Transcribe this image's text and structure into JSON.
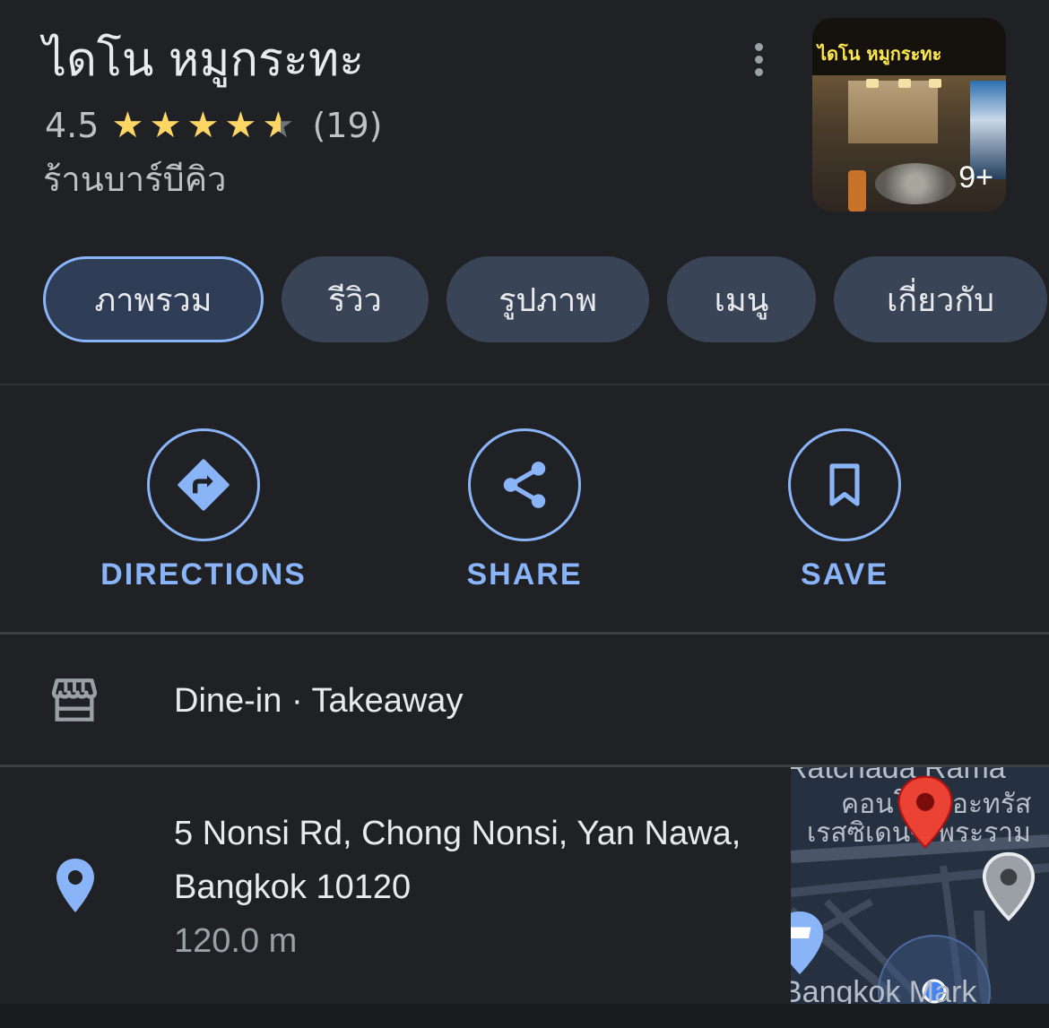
{
  "place": {
    "name": "ไดโน หมูกระทะ",
    "rating": "4.5",
    "rating_value": 4.5,
    "review_count": "(19)",
    "category": "ร้านบาร์บีคิว",
    "photo_sign": "ไดโน หมูกระทะ",
    "photo_count": "9+"
  },
  "tabs": [
    {
      "label": "ภาพรวม",
      "active": true
    },
    {
      "label": "รีวิว",
      "active": false
    },
    {
      "label": "รูปภาพ",
      "active": false
    },
    {
      "label": "เมนู",
      "active": false
    },
    {
      "label": "เกี่ยวกับ",
      "active": false
    }
  ],
  "actions": {
    "directions": {
      "label": "DIRECTIONS",
      "icon": "directions-icon"
    },
    "share": {
      "label": "SHARE",
      "icon": "share-icon"
    },
    "save": {
      "label": "SAVE",
      "icon": "bookmark-icon"
    }
  },
  "service": {
    "icon": "storefront-icon",
    "text": "Dine-in · Takeaway"
  },
  "location": {
    "icon": "location-pin-icon",
    "address": "5 Nonsi Rd, Chong Nonsi, Yan Nawa, Bangkok 10120",
    "distance": "120.0 m"
  },
  "map": {
    "label_top": "Ratchada Rama",
    "label_line1": "คอนโดเดอะทรัส",
    "label_line2": "เรสซิเดนซ์ พระราม",
    "label_bottom": "Bangkok Mark"
  },
  "colors": {
    "background": "#202124",
    "accent": "#8ab4f8",
    "star": "#fdd663",
    "tab": "#394457",
    "map_pin": "#ea4335"
  }
}
